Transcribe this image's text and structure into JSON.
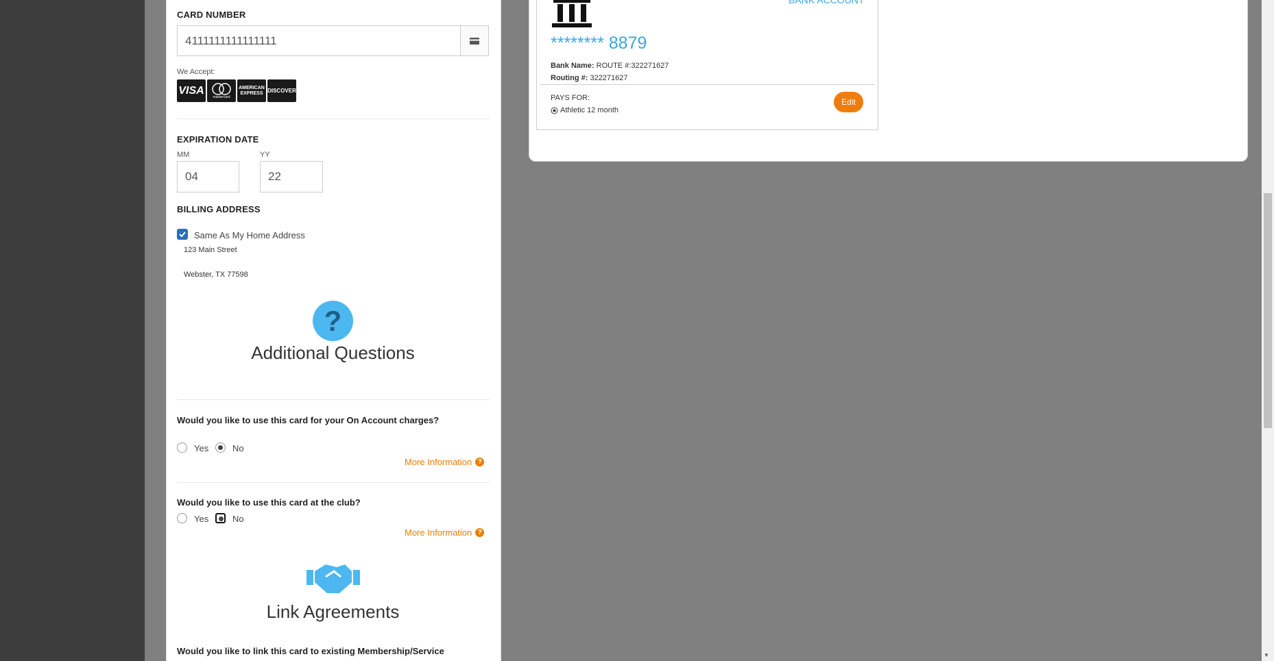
{
  "form": {
    "card_number_label": "CARD NUMBER",
    "card_number_value": "4111111111111111",
    "we_accept_label": "We Accept:",
    "card_brands": [
      "VISA",
      "mastercard",
      "AMERICAN EXPRESS",
      "DISCOVER"
    ],
    "expiration_label": "EXPIRATION DATE",
    "mm_label": "MM",
    "mm_value": "04",
    "yy_label": "YY",
    "yy_value": "22",
    "billing_label": "BILLING ADDRESS",
    "same_address_label": "Same As My Home Address",
    "address_line1": "123 Main Street",
    "address_line2": "Webster, TX 77598"
  },
  "additional_questions": {
    "title": "Additional Questions",
    "q1": "Would you like to use this card for your On Account charges?",
    "q2": "Would you like to use this card at the club?",
    "yes_label": "Yes",
    "no_label": "No",
    "more_info_label": "More Information"
  },
  "link_agreements": {
    "title": "Link Agreements",
    "question": "Would you like to link this card to existing Membership/Service"
  },
  "bank_card": {
    "type_label": "BANK ACCOUNT",
    "masked_number": "******** 8879",
    "bank_name_label": "Bank Name:",
    "bank_name_value": "ROUTE #:322271627",
    "routing_label": "Routing #:",
    "routing_value": "322271627",
    "pays_for_label": "PAYS FOR:",
    "pays_for_item": "Athletic 12 month",
    "edit_label": "Edit"
  },
  "colors": {
    "accent_orange": "#f07c0c",
    "link_orange": "#e87e04",
    "bank_blue": "#3aa8e0",
    "icon_blue": "#4db8f0",
    "checkbox_blue": "#2a6fb8"
  }
}
